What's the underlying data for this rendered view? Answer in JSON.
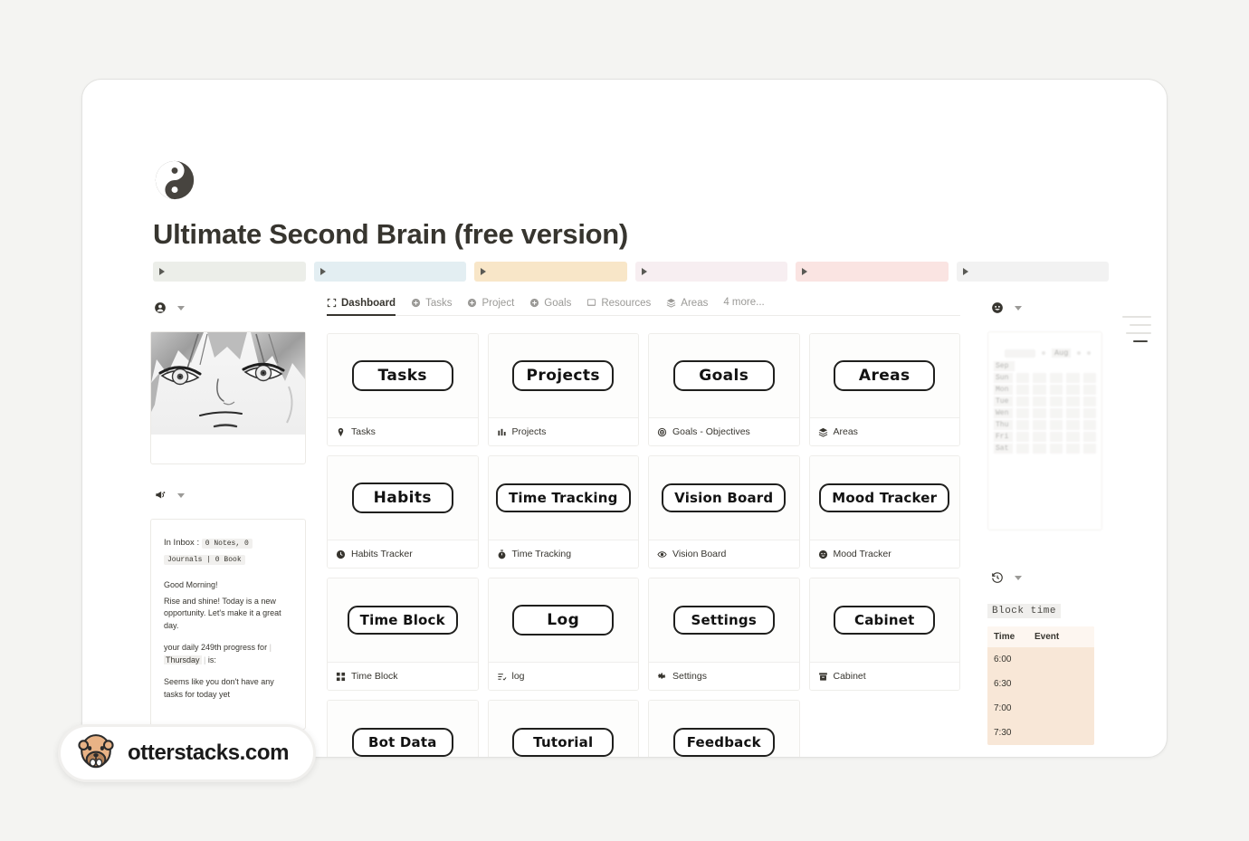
{
  "page": {
    "icon_name": "yin-yang-icon",
    "title": "Ultimate Second Brain (free version)"
  },
  "toggle_bars": [
    {
      "name": "toggle-bar-1",
      "color": "#eceee9"
    },
    {
      "name": "toggle-bar-2",
      "color": "#e3eef2"
    },
    {
      "name": "toggle-bar-3",
      "color": "#f8e6c8"
    },
    {
      "name": "toggle-bar-4",
      "color": "#f7eef1"
    },
    {
      "name": "toggle-bar-5",
      "color": "#fae4e2"
    },
    {
      "name": "toggle-bar-6",
      "color": "#f2f2f2"
    }
  ],
  "left_sidebar": {
    "portrait_block": {
      "icon": "person-circle-icon",
      "caption": ""
    },
    "inbox_block": {
      "icon": "megaphone-icon",
      "inbox_label": "In Inbox :",
      "inbox_chip_1": "0 Notes, 0",
      "inbox_chip_2": "Journals | 0 Book",
      "greeting": "Good Morning!",
      "greeting_body": " Rise and shine! Today is a new opportunity. Let's make it a great day.",
      "progress_prefix": "your daily 249th progress for",
      "progress_day": "Thursday",
      "progress_suffix": "is:",
      "no_tasks": "Seems like you don't have any tasks for today yet"
    }
  },
  "tabs": [
    {
      "label": "Dashboard",
      "icon": "frame-icon",
      "active": true
    },
    {
      "label": "Tasks",
      "icon": "plus-circle-icon",
      "active": false
    },
    {
      "label": "Project",
      "icon": "plus-circle-icon",
      "active": false
    },
    {
      "label": "Goals",
      "icon": "plus-circle-icon",
      "active": false
    },
    {
      "label": "Resources",
      "icon": "book-icon",
      "active": false
    },
    {
      "label": "Areas",
      "icon": "layers-icon",
      "active": false
    }
  ],
  "tabs_more": "4 more...",
  "cards": [
    {
      "title": "Tasks",
      "footer": "Tasks",
      "icon": "pin-icon"
    },
    {
      "title": "Projects",
      "footer": "Projects",
      "icon": "bar-chart-icon"
    },
    {
      "title": "Goals",
      "footer": "Goals - Objectives",
      "icon": "target-icon"
    },
    {
      "title": "Areas",
      "footer": "Areas",
      "icon": "layers-icon"
    },
    {
      "title": "Habits",
      "footer": "Habits Tracker",
      "icon": "clock-icon"
    },
    {
      "title": "Time Tracking",
      "footer": "Time Tracking",
      "icon": "stopwatch-icon"
    },
    {
      "title": "Vision Board",
      "footer": "Vision Board",
      "icon": "eye-icon"
    },
    {
      "title": "Mood Tracker",
      "footer": "Mood Tracker",
      "icon": "smiley-icon"
    },
    {
      "title": "Time Block",
      "footer": "Time Block",
      "icon": "grid-icon"
    },
    {
      "title": "Log",
      "footer": "log",
      "icon": "list-check-icon"
    },
    {
      "title": "Settings",
      "footer": "Settings",
      "icon": "gear-icon"
    },
    {
      "title": "Cabinet",
      "footer": "Cabinet",
      "icon": "archive-icon"
    }
  ],
  "cards_cut": [
    {
      "title": "Bot Data"
    },
    {
      "title": "Tutorial"
    },
    {
      "title": "Feedback"
    }
  ],
  "right_sidebar": {
    "calendar_block": {
      "icon": "smiley-icon",
      "month_prev": "Sep",
      "month_current": "Aug",
      "weekdays": [
        "Sun",
        "Mon",
        "Tue",
        "Wen",
        "Thu",
        "Fri",
        "Sat"
      ]
    },
    "block_time": {
      "icon": "history-icon",
      "title": "Block time",
      "columns": [
        "Time",
        "Event"
      ],
      "rows": [
        {
          "time": "6:00",
          "event": ""
        },
        {
          "time": "6:30",
          "event": ""
        },
        {
          "time": "7:00",
          "event": ""
        },
        {
          "time": "7:30",
          "event": ""
        }
      ],
      "bg_color": "#f8e7d7"
    }
  },
  "watermark": {
    "text": "otterstacks.com",
    "icon": "otter-face-icon"
  }
}
